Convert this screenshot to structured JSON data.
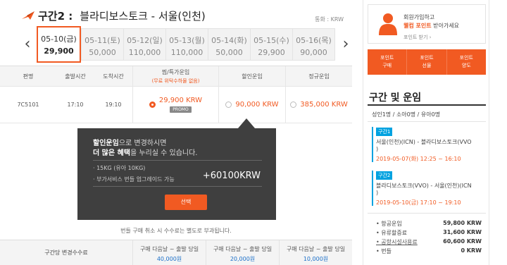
{
  "header": {
    "segment": "구간2 :",
    "route": "블라디보스토크 - 서울(인천)",
    "currency": "통화 : KRW"
  },
  "dates": [
    {
      "date": "05-10(금)",
      "price": "29,900",
      "active": true
    },
    {
      "date": "05-11(토)",
      "price": "50,000"
    },
    {
      "date": "05-12(일)",
      "price": "110,000"
    },
    {
      "date": "05-13(월)",
      "price": "110,000"
    },
    {
      "date": "05-14(화)",
      "price": "50,000"
    },
    {
      "date": "05-15(수)",
      "price": "29,900"
    },
    {
      "date": "05-16(목)",
      "price": "90,000"
    }
  ],
  "table": {
    "headers": {
      "flight": "편명",
      "depart": "출발시간",
      "arrive": "도착시간",
      "special": "찜/특가운임",
      "special_sub": "(무료 위탁수하물 없음)",
      "discount": "할인운임",
      "regular": "정규운임"
    },
    "row": {
      "flight": "7C5101",
      "depart": "17:10",
      "arrive": "19:10",
      "special_price": "29,900 KRW",
      "promo": "PROMO",
      "discount_price": "90,000 KRW",
      "regular_price": "385,000 KRW"
    }
  },
  "tooltip": {
    "line1_strong": "할인운임",
    "line1_rest": "으로 변경하시면",
    "line2_strong": "더 많은 혜택",
    "line2_rest": "을 누리실 수 있습니다.",
    "item1": "· 15KG (유아 10KG)",
    "item2": "· 부가서비스 번들 업그레이드 가능",
    "plus": "+60100KRW",
    "select": "선택"
  },
  "note": "번들 구매 취소 시 수수료는 별도로 부과됩니다.",
  "fees": {
    "label": "구간당 변경수수료",
    "cells": [
      {
        "h": "구매 다음날 ~ 출발 당일",
        "v": "40,000원"
      },
      {
        "h": "구매 다음날 ~ 출발 당일",
        "v": "20,000원"
      },
      {
        "h": "구매 다음날 ~ 출발 당일",
        "v": "10,000원"
      }
    ]
  },
  "sidebar": {
    "promo_line1": "회원가입하고",
    "promo_hl": "웰컴 포인트",
    "promo_rest": " 받아가세요",
    "promo_link": "포인트 받기 ›",
    "points": [
      {
        "l1": "포인트",
        "l2": "구매"
      },
      {
        "l1": "포인트",
        "l2": "선물"
      },
      {
        "l1": "포인트",
        "l2": "양도"
      }
    ],
    "title": "구간 및 운임",
    "pax": "성인1명 / 소아0명 / 유아0명",
    "seg1": {
      "tag": "구간1",
      "route1": "서울(인천)(ICN) - 블라디보스토크(VVO",
      "route2": ")",
      "time": "2019-05-07(화) 12:25 ~ 16:10"
    },
    "seg2": {
      "tag": "구간2",
      "route1": "블라디보스토크(VVO) - 서울(인천)(ICN",
      "route2": ")",
      "time": "2019-05-10(금) 17:10 ~ 19:10"
    },
    "fares": [
      {
        "label": "• 항공운임",
        "value": "59,800 KRW"
      },
      {
        "label": "• 유류할증료",
        "value": "31,600 KRW"
      },
      {
        "label": "• 공항시설사용료",
        "value": "60,600 KRW",
        "link": true
      },
      {
        "label": "• 번들",
        "value": "0 KRW"
      }
    ]
  }
}
